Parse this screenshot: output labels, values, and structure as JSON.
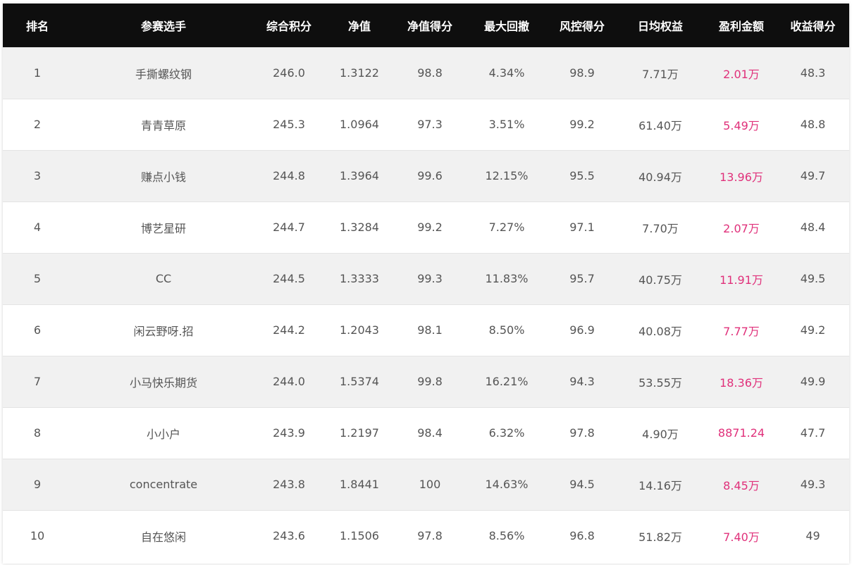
{
  "headers": [
    "排名",
    "参赛选手",
    "综合积分",
    "净值",
    "净值得分",
    "最大回撤",
    "风控得分",
    "日均权益",
    "盈利金额",
    "收益得分"
  ],
  "rows": [
    [
      "1",
      "手撕螺纹钢",
      "246.0",
      "1.3122",
      "98.8",
      "4.34%",
      "98.9",
      "7.71万",
      "2.01万",
      "48.3"
    ],
    [
      "2",
      "青青草原",
      "245.3",
      "1.0964",
      "97.3",
      "3.51%",
      "99.2",
      "61.40万",
      "5.49万",
      "48.8"
    ],
    [
      "3",
      "赚点小钱",
      "244.8",
      "1.3964",
      "99.6",
      "12.15%",
      "95.5",
      "40.94万",
      "13.96万",
      "49.7"
    ],
    [
      "4",
      "博艺星研",
      "244.7",
      "1.3284",
      "99.2",
      "7.27%",
      "97.1",
      "7.70万",
      "2.07万",
      "48.4"
    ],
    [
      "5",
      "CC",
      "244.5",
      "1.3333",
      "99.3",
      "11.83%",
      "95.7",
      "40.75万",
      "11.91万",
      "49.5"
    ],
    [
      "6",
      "闲云野呀.招",
      "244.2",
      "1.2043",
      "98.1",
      "8.50%",
      "96.9",
      "40.08万",
      "7.77万",
      "49.2"
    ],
    [
      "7",
      "小马快乐期货",
      "244.0",
      "1.5374",
      "99.8",
      "16.21%",
      "94.3",
      "53.55万",
      "18.36万",
      "49.9"
    ],
    [
      "8",
      "小小户",
      "243.9",
      "1.2197",
      "98.4",
      "6.32%",
      "97.8",
      "4.90万",
      "8871.24",
      "47.7"
    ],
    [
      "9",
      "concentrate",
      "243.8",
      "1.8441",
      "100",
      "14.63%",
      "94.5",
      "14.16万",
      "8.45万",
      "49.3"
    ],
    [
      "10",
      "自在悠闲",
      "243.6",
      "1.1506",
      "97.8",
      "8.56%",
      "96.8",
      "51.82万",
      "7.40万",
      "49"
    ]
  ],
  "colors": {
    "header_bg": "#0e0e0e",
    "profit": "#e0307a",
    "stripe": "#f1f1f1"
  }
}
